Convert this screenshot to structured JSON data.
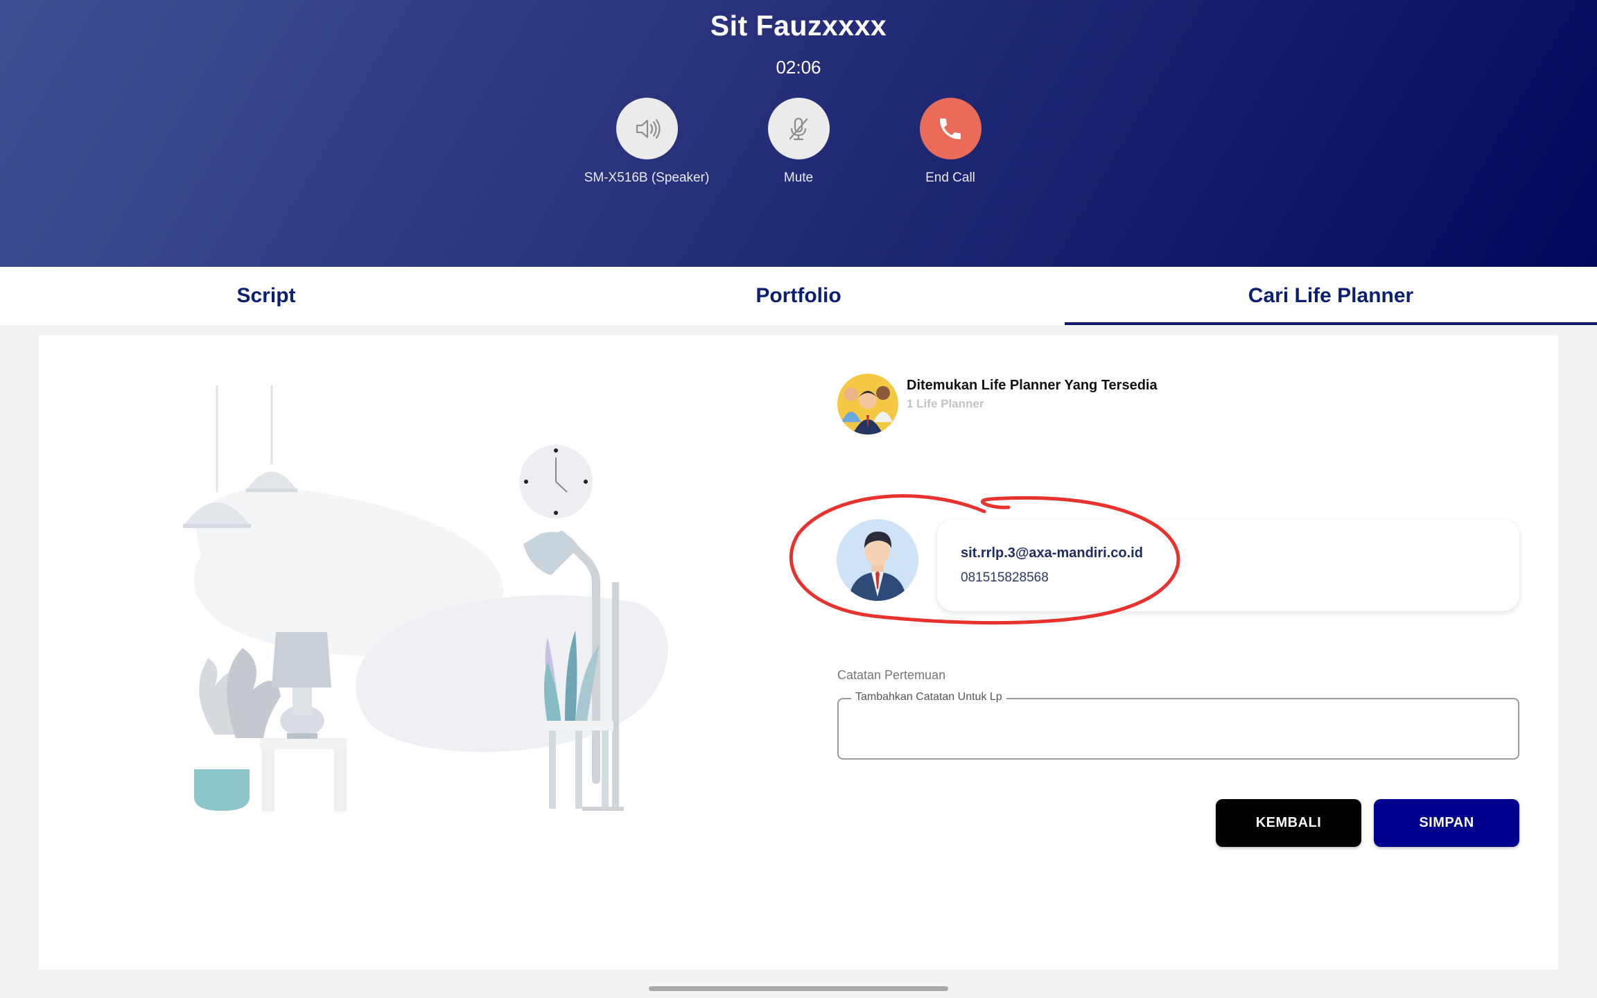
{
  "call": {
    "caller_name": "Sit Fauzxxxx",
    "timer": "02:06",
    "controls": {
      "speaker_label": "SM-X516B (Speaker)",
      "mute_label": "Mute",
      "end_call_label": "End Call"
    },
    "colors": {
      "end_call": "#e96b58",
      "header_start": "#3f4f94",
      "header_end": "#03085a"
    }
  },
  "tabs": [
    {
      "label": "Script",
      "active": false
    },
    {
      "label": "Portfolio",
      "active": false
    },
    {
      "label": "Cari Life Planner",
      "active": true
    }
  ],
  "search_result": {
    "title": "Ditemukan Life Planner Yang Tersedia",
    "count_label": "1 Life Planner"
  },
  "planner": {
    "email": "sit.rrlp.3@axa-mandiri.co.id",
    "phone": "081515828568"
  },
  "notes": {
    "label": "Catatan Pertemuan",
    "field_label": "Tambahkan Catatan Untuk Lp",
    "value": ""
  },
  "actions": {
    "back_label": "KEMBALI",
    "save_label": "SIMPAN"
  }
}
